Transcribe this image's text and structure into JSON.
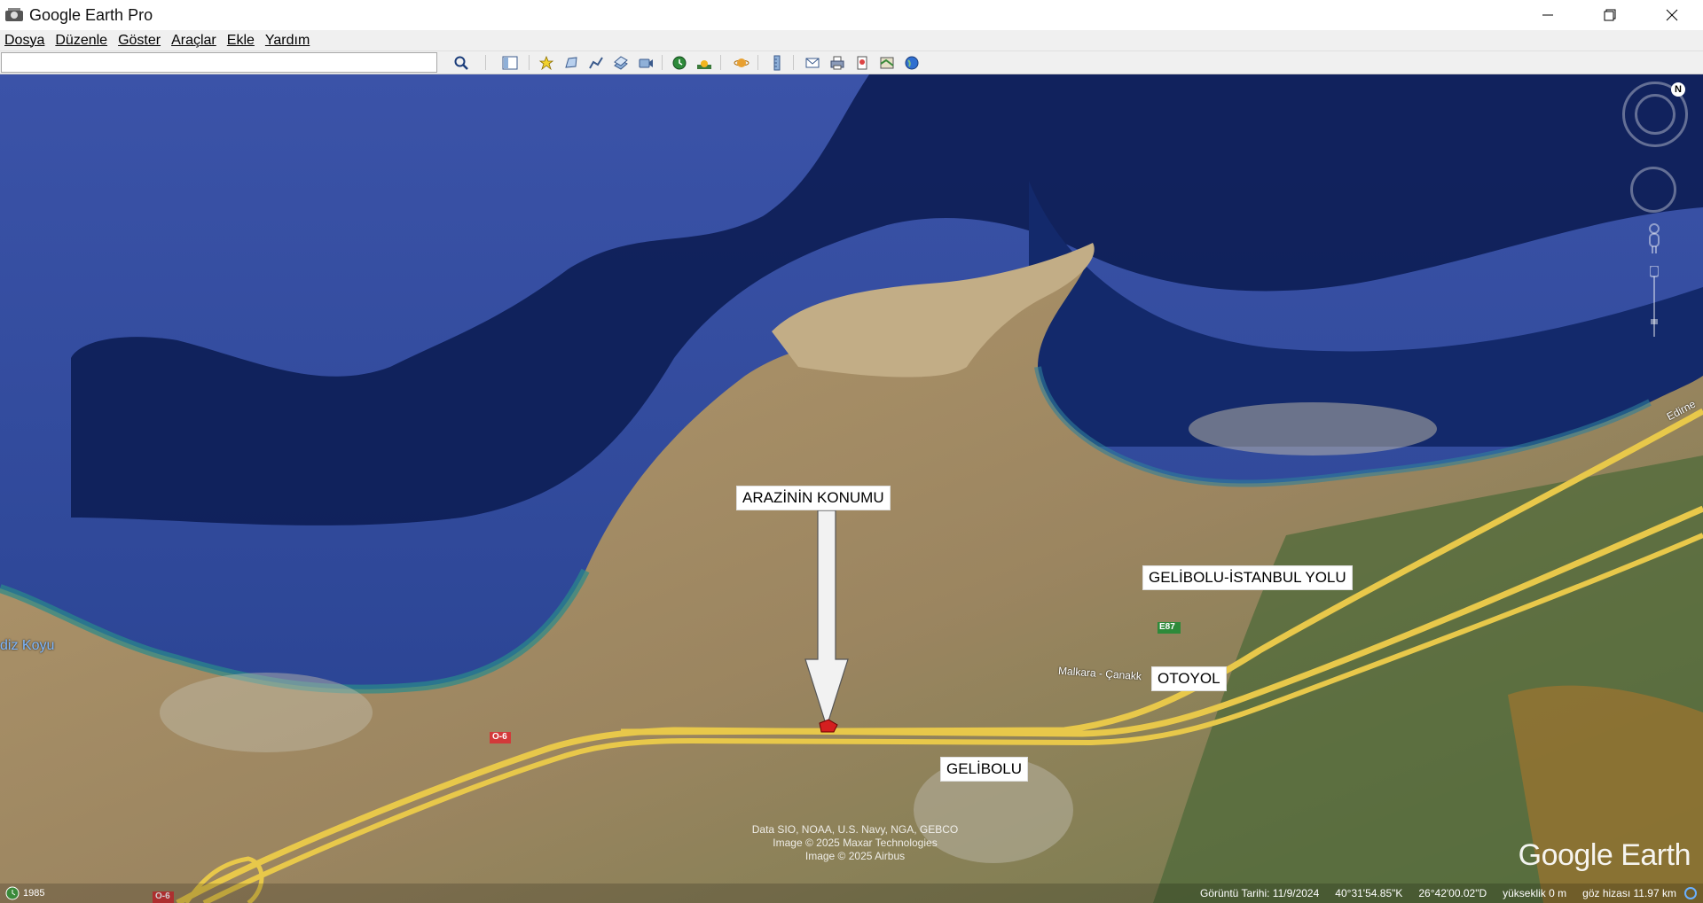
{
  "window": {
    "title": "Google Earth Pro"
  },
  "menu": {
    "items": [
      "Dosya",
      "Düzenle",
      "Göster",
      "Araçlar",
      "Ekle",
      "Yardım"
    ]
  },
  "search": {
    "value": "",
    "placeholder": ""
  },
  "map": {
    "annotations": {
      "parcel_location": "ARAZİNİN KONUMU",
      "road_istanbul": "GELİBOLU-İSTANBUL YOLU",
      "motorway": "OTOYOL",
      "town": "GELİBOLU"
    },
    "place_labels": {
      "bay": "diz Koyu",
      "road_name": "Malkara - Çanakk",
      "road_east": "Edirne",
      "shield_e87": "E87",
      "shield_o6_a": "O-6",
      "shield_o6_b": "O-6"
    },
    "attribution": [
      "Data SIO, NOAA, U.S. Navy, NGA, GEBCO",
      "Image © 2025 Maxar Technologies",
      "Image © 2025 Airbus"
    ],
    "logo": "Google Earth",
    "north": "N"
  },
  "status": {
    "historical_year": "1985",
    "imagery_date": "Görüntü Tarihi: 11/9/2024",
    "lat": "40°31'54.85\"K",
    "lon": "26°42'00.02\"D",
    "elevation": "yükseklik   0 m",
    "eye_alt": "göz hizası  11.97 km"
  },
  "colors": {
    "sea_deep": "#0d1f52",
    "sea_shallow": "#2e4aa0",
    "land": "#a08a63",
    "road": "#e8c84a"
  }
}
